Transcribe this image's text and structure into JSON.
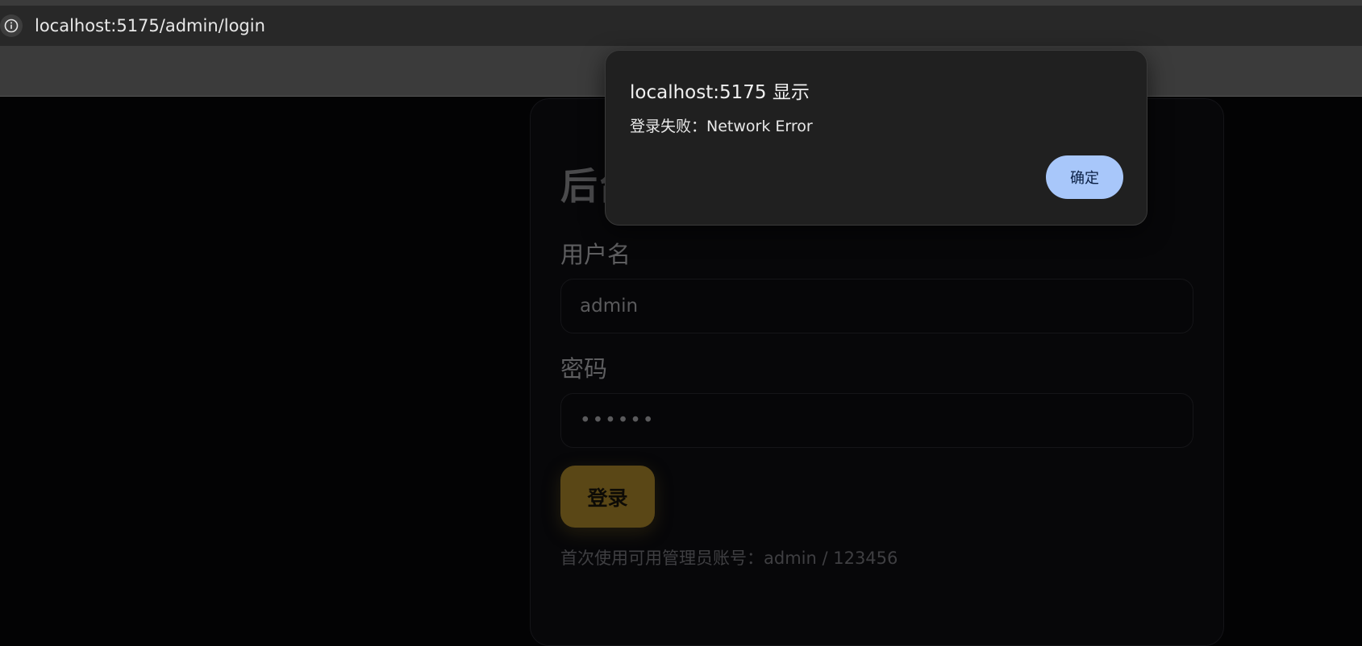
{
  "browser": {
    "url": "localhost:5175/admin/login"
  },
  "login": {
    "title": "后台",
    "username_label": "用户名",
    "username_value": "admin",
    "password_label": "密码",
    "password_value": "••••••",
    "submit_label": "登录",
    "hint": "首次使用可用管理员账号：admin / 123456"
  },
  "dialog": {
    "title": "localhost:5175 显示",
    "message": "登录失败：Network Error",
    "ok_label": "确定"
  },
  "colors": {
    "accent_button": "#5a4716",
    "dialog_ok": "#a8c7fa",
    "page_background": "#030304"
  }
}
